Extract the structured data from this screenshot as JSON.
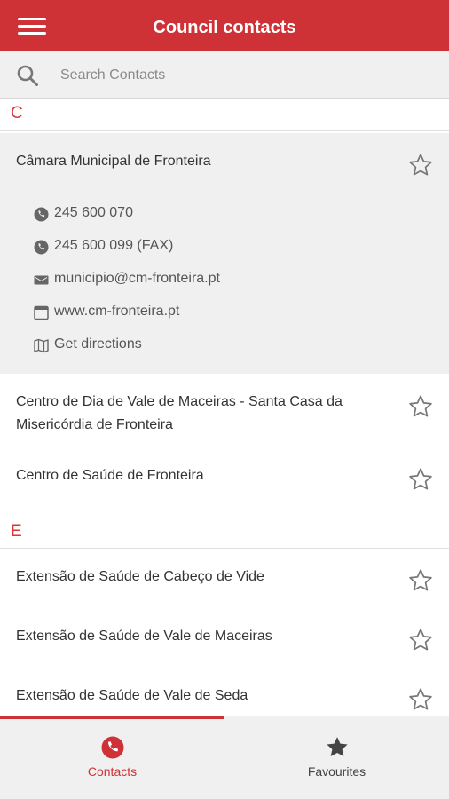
{
  "app": {
    "title": "Council contacts",
    "menu_icon": "hamburger-menu-icon",
    "accent_color": "#cf3236"
  },
  "search": {
    "placeholder": "Search Contacts",
    "icon": "search-icon"
  },
  "sections": [
    {
      "letter": "C",
      "items": [
        {
          "name": "Câmara Municipal de Fronteira",
          "expanded": true,
          "details": [
            {
              "icon": "phone-icon",
              "text": "245 600 070"
            },
            {
              "icon": "phone-icon",
              "text": "245 600 099 (FAX)"
            },
            {
              "icon": "email-icon",
              "text": "municipio@cm-fronteira.pt"
            },
            {
              "icon": "browser-icon",
              "text": "www.cm-fronteira.pt"
            },
            {
              "icon": "directions-map-icon",
              "text": "Get directions"
            }
          ]
        },
        {
          "name": "Centro de Dia de Vale de Maceiras - Santa Casa da Misericórdia de Fronteira"
        },
        {
          "name": "Centro de Saúde de Fronteira"
        }
      ]
    },
    {
      "letter": "E",
      "items": [
        {
          "name": "Extensão de Saúde de Cabeço de Vide"
        },
        {
          "name": "Extensão de Saúde de Vale de Maceiras"
        },
        {
          "name": "Extensão de Saúde de Vale de Seda"
        }
      ]
    }
  ],
  "tab_indicator_fraction": 0.5,
  "bottom_nav": [
    {
      "label": "Contacts",
      "icon": "phone-circle-icon",
      "active": true,
      "color": "#cf3236"
    },
    {
      "label": "Favourites",
      "icon": "star-filled-icon",
      "active": false,
      "color": "#444444"
    }
  ]
}
